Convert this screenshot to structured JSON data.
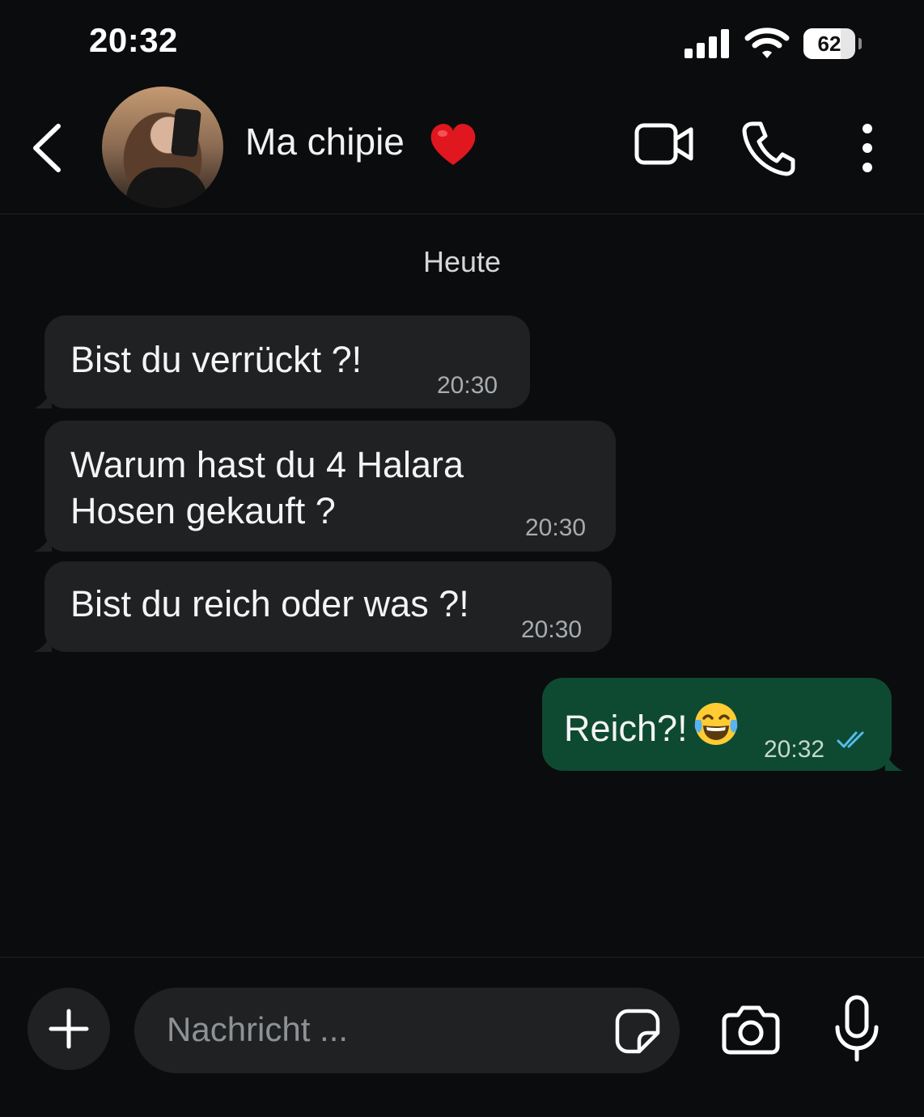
{
  "status_bar": {
    "time": "20:32",
    "battery_percent": "62",
    "icons": [
      "signal-icon",
      "wifi-icon",
      "battery-icon"
    ]
  },
  "header": {
    "contact_name": "Ma chipie",
    "name_emoji": "heart-emoji",
    "icons": [
      "back-icon",
      "video-call-icon",
      "voice-call-icon",
      "more-icon"
    ]
  },
  "chat": {
    "date_separator": "Heute",
    "messages": [
      {
        "direction": "incoming",
        "text": "Bist du verrückt ?!",
        "time": "20:30"
      },
      {
        "direction": "incoming",
        "text_line1": "Warum hast du 4 Halara",
        "text_line2": "Hosen gekauft ?",
        "time": "20:30"
      },
      {
        "direction": "incoming",
        "text": "Bist du reich oder was ?!",
        "time": "20:30"
      },
      {
        "direction": "outgoing",
        "text": "Reich?!",
        "emoji": "tears-of-joy-emoji",
        "time": "20:32",
        "status": "read"
      }
    ]
  },
  "composer": {
    "placeholder": "Nachricht ...",
    "icons": [
      "plus-icon",
      "sticker-icon",
      "camera-icon",
      "microphone-icon"
    ]
  },
  "colors": {
    "background": "#0b0c0d",
    "incoming_bubble": "#1f2123",
    "outgoing_bubble": "#0e4a32",
    "read_ticks": "#53bdeb",
    "heart": "#e0171f"
  }
}
